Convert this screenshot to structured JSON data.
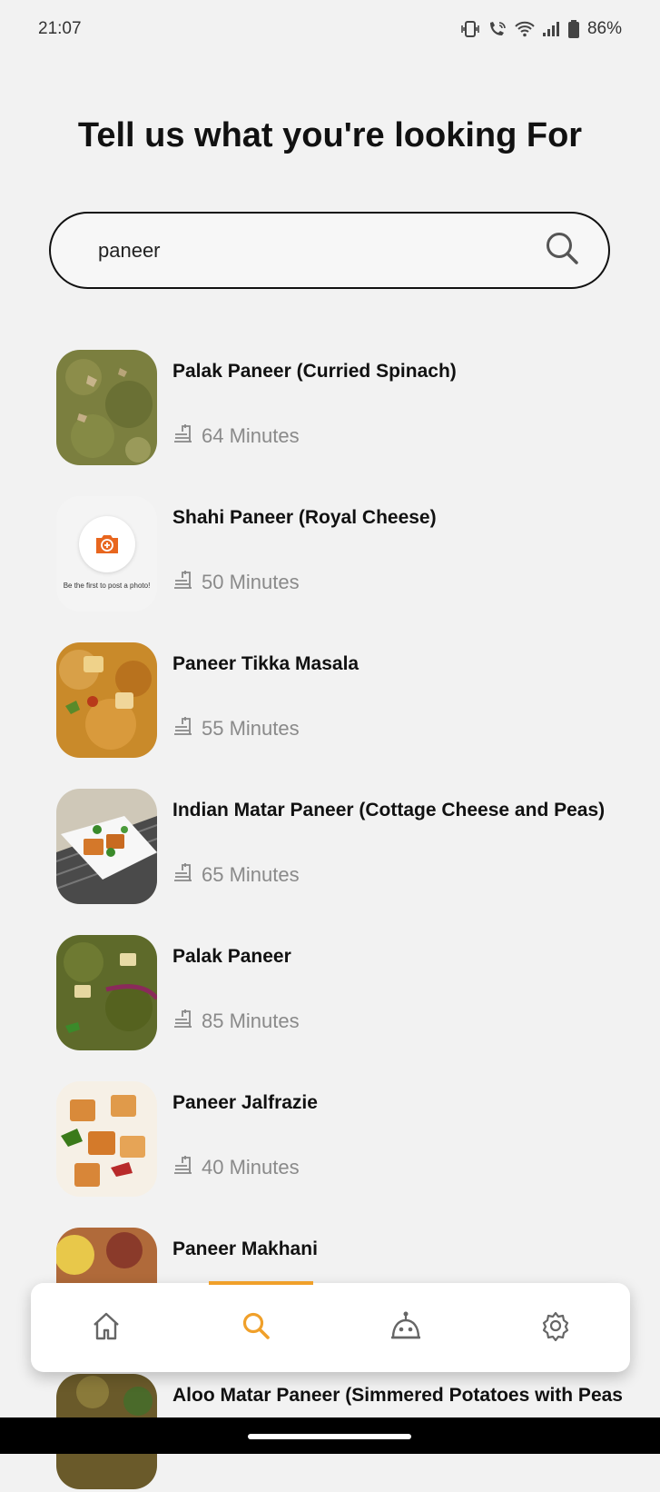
{
  "status_bar": {
    "time": "21:07",
    "battery": "86%",
    "icons": [
      "vibrate-icon",
      "wifi-call-icon",
      "wifi-icon",
      "signal-icon",
      "battery-icon"
    ]
  },
  "title": "Tell us what you're looking For",
  "search": {
    "value": "paneer",
    "icon": "search-icon"
  },
  "recipes": [
    {
      "title": "Palak Paneer (Curried Spinach)",
      "time": "64 Minutes"
    },
    {
      "title": "Shahi Paneer (Royal Cheese)",
      "time": "50 Minutes",
      "placeholder_caption": "Be the first to post a photo!"
    },
    {
      "title": "Paneer Tikka Masala",
      "time": "55 Minutes"
    },
    {
      "title": "Indian Matar Paneer (Cottage Cheese and Peas)",
      "time": "65 Minutes"
    },
    {
      "title": "Palak Paneer",
      "time": "85 Minutes"
    },
    {
      "title": "Paneer Jalfrazie",
      "time": "40 Minutes"
    },
    {
      "title": "Paneer Makhani",
      "time": ""
    },
    {
      "title": "Aloo Matar Paneer (Simmered Potatoes with Peas",
      "time": ""
    }
  ],
  "nav": {
    "items": [
      "home-icon",
      "search-icon",
      "robot-icon",
      "settings-icon"
    ],
    "active": "search",
    "accent_color": "#f0a02a"
  },
  "colors": {
    "background": "#f2f2f2",
    "accent": "#f0a02a",
    "camera": "#e8661e"
  }
}
